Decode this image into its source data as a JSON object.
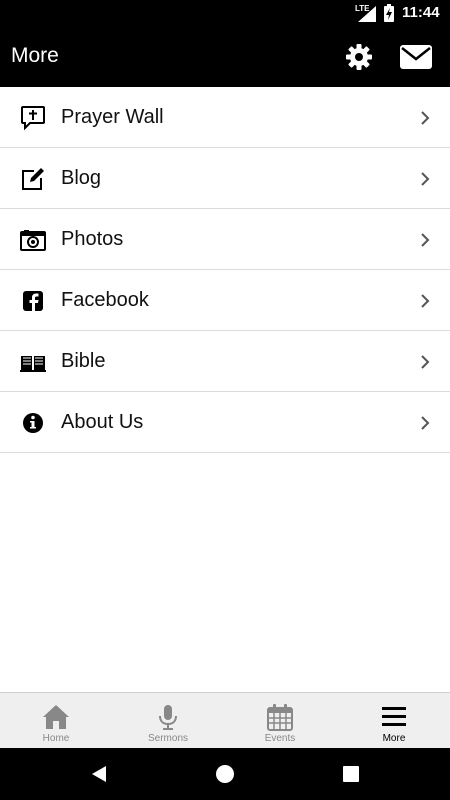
{
  "status_bar": {
    "network": "LTE",
    "time": "11:44"
  },
  "app_bar": {
    "title": "More",
    "actions": [
      {
        "icon": "gear-icon"
      },
      {
        "icon": "mail-icon"
      }
    ]
  },
  "menu": {
    "items": [
      {
        "label": "Prayer Wall",
        "icon": "prayer-icon"
      },
      {
        "label": "Blog",
        "icon": "edit-icon"
      },
      {
        "label": "Photos",
        "icon": "camera-icon"
      },
      {
        "label": "Facebook",
        "icon": "facebook-icon"
      },
      {
        "label": "Bible",
        "icon": "book-icon"
      },
      {
        "label": "About Us",
        "icon": "info-icon"
      }
    ]
  },
  "tab_bar": {
    "tabs": [
      {
        "label": "Home",
        "icon": "home-icon",
        "active": false
      },
      {
        "label": "Sermons",
        "icon": "microphone-icon",
        "active": false
      },
      {
        "label": "Events",
        "icon": "calendar-icon",
        "active": false
      },
      {
        "label": "More",
        "icon": "menu-icon",
        "active": true
      }
    ]
  },
  "colors": {
    "app_bar_bg": "#000000",
    "tab_inactive": "#888888",
    "tab_active": "#000000",
    "divider": "#dcdcdc"
  }
}
